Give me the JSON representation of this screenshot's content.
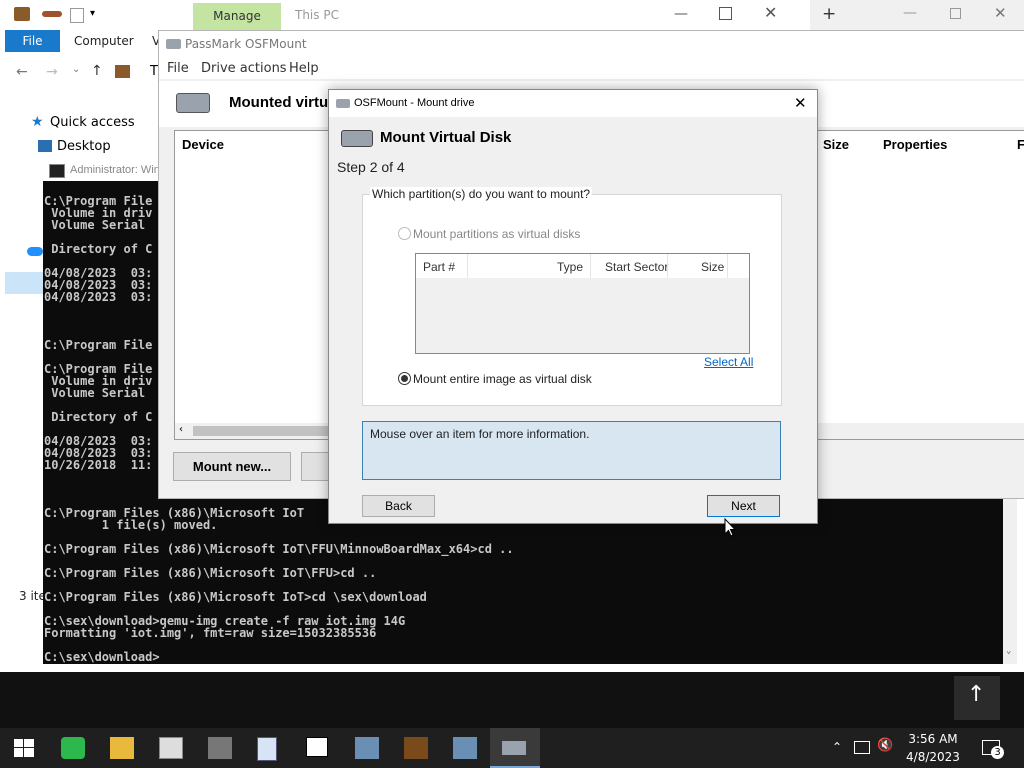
{
  "explorer": {
    "manage_tab": "Manage",
    "location": "This PC",
    "ribbon_file": "File",
    "ribbon_computer": "Computer",
    "ribbon_view": "V",
    "address_prefix": "T",
    "sidebar": {
      "quick_access": "Quick access",
      "desktop": "Desktop"
    },
    "status": "3 ite"
  },
  "cmd": {
    "title": "Administrator: Win",
    "lines": [
      "C:\\Program File",
      " Volume in driv",
      " Volume Serial",
      "",
      " Directory of C",
      "",
      "04/08/2023  03:",
      "04/08/2023  03:",
      "04/08/2023  03:",
      "",
      "",
      "",
      "C:\\Program File",
      "",
      "C:\\Program File",
      " Volume in driv",
      " Volume Serial",
      "",
      " Directory of C",
      "",
      "04/08/2023  03:",
      "04/08/2023  03:",
      "10/26/2018  11:",
      "",
      "",
      "",
      "C:\\Program Files (x86)\\Microsoft IoT",
      "        1 file(s) moved.",
      "",
      "C:\\Program Files (x86)\\Microsoft IoT\\FFU\\MinnowBoardMax_x64>cd ..",
      "",
      "C:\\Program Files (x86)\\Microsoft IoT\\FFU>cd ..",
      "",
      "C:\\Program Files (x86)\\Microsoft IoT>cd \\sex\\download",
      "",
      "C:\\sex\\download>qemu-img create -f raw iot.img 14G",
      "Formatting 'iot.img', fmt=raw size=15032385536",
      "",
      "C:\\sex\\download>"
    ]
  },
  "osf": {
    "title": "PassMark OSFMount",
    "menu": {
      "file": "File",
      "drive_actions": "Drive actions",
      "help": "Help"
    },
    "header_title": "Mounted virtuo",
    "columns": {
      "device": "Device",
      "size": "Size",
      "properties": "Properties",
      "more": "F"
    },
    "mount_new": "Mount new..."
  },
  "dialog": {
    "title": "OSFMount - Mount drive",
    "heading": "Mount Virtual Disk",
    "step": "Step 2 of 4",
    "group_label": "Which partition(s) do you want to mount?",
    "radio_partitions": "Mount partitions as virtual disks",
    "table_columns": {
      "part": "Part #",
      "type": "Type",
      "start_sector": "Start Sector",
      "size": "Size"
    },
    "select_all": "Select All",
    "radio_entire": "Mount entire image as virtual disk",
    "info_text": "Mouse over an item for more information.",
    "back": "Back",
    "next": "Next"
  },
  "taskbar": {
    "time": "3:56 AM",
    "date": "4/8/2023",
    "notifications": "3",
    "icons": [
      "start-icon",
      "sheets-icon",
      "file-explorer-icon",
      "calculator-icon",
      "device-icon",
      "notepad-icon",
      "7zip-icon",
      "network-app-icon",
      "minnowboard-app-icon",
      "network-app2-icon",
      "osfmount-icon"
    ]
  },
  "colors": {
    "accent": "#1979ca",
    "manage": "#c3e5a1",
    "info_bg": "#d8e6f2",
    "link": "#0066cc"
  }
}
